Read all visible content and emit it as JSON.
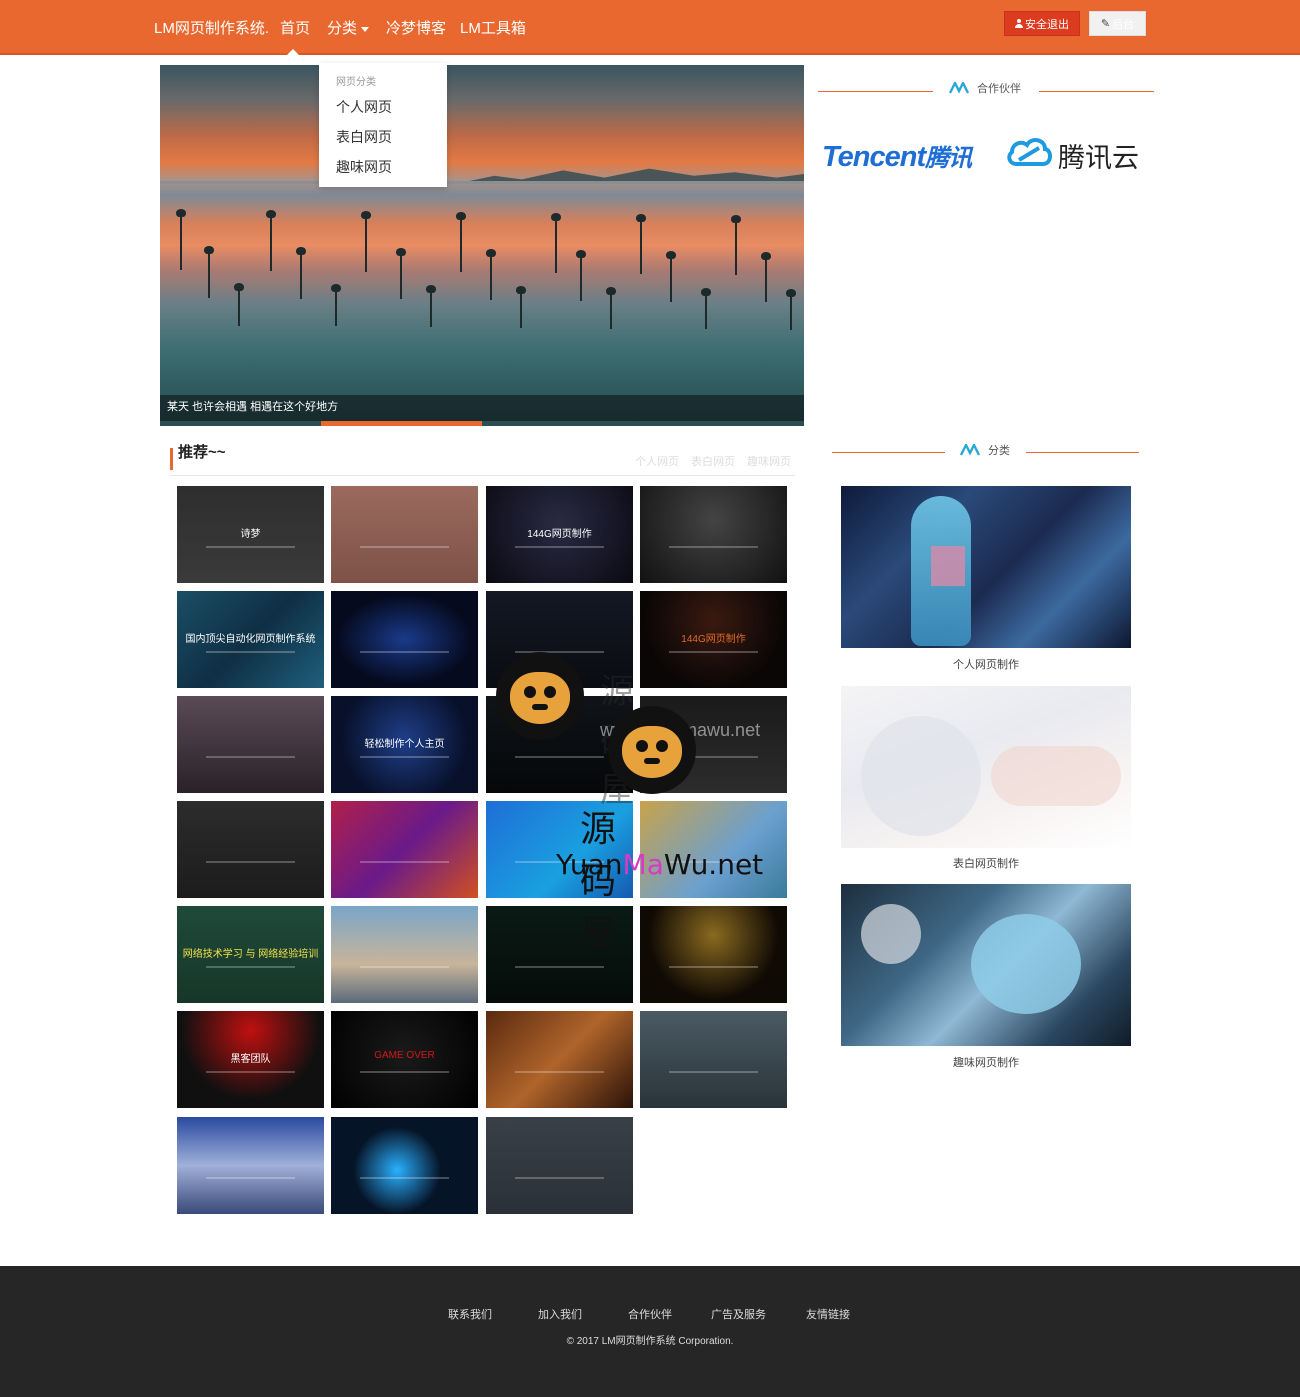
{
  "nav": {
    "brand": "LM网页制作系统.",
    "items": [
      {
        "label": "首页"
      },
      {
        "label": "分类"
      },
      {
        "label": "冷梦博客"
      },
      {
        "label": "LM工具箱"
      }
    ],
    "logout_label": "安全退出",
    "edit_label": "后台"
  },
  "dropdown": {
    "header": "网页分类",
    "items": [
      {
        "label": "个人网页"
      },
      {
        "label": "表白网页"
      },
      {
        "label": "趣味网页"
      }
    ]
  },
  "hero": {
    "caption": "某天 也许会相遇 相遇在这个好地方",
    "progress_fraction": 0.25
  },
  "recommend": {
    "title": "推荐~~",
    "tabs": [
      {
        "label": "个人网页"
      },
      {
        "label": "表白网页"
      },
      {
        "label": "趣味网页"
      }
    ],
    "thumbs": [
      {
        "text": "诗梦"
      },
      {
        "text": ""
      },
      {
        "text": "144G网页制作"
      },
      {
        "text": ""
      },
      {
        "text": "国内顶尖自动化网页制作系统"
      },
      {
        "text": ""
      },
      {
        "text": ""
      },
      {
        "text": "144G网页制作"
      },
      {
        "text": ""
      },
      {
        "text": "轻松制作个人主页"
      },
      {
        "text": ""
      },
      {
        "text": ""
      },
      {
        "text": ""
      },
      {
        "text": ""
      },
      {
        "text": ""
      },
      {
        "text": ""
      },
      {
        "text": "网络技术学习 与 网络经验培训"
      },
      {
        "text": ""
      },
      {
        "text": ""
      },
      {
        "text": ""
      },
      {
        "text": "黑客团队"
      },
      {
        "text": "GAME OVER"
      },
      {
        "text": ""
      },
      {
        "text": ""
      },
      {
        "text": ""
      },
      {
        "text": ""
      },
      {
        "text": ""
      }
    ]
  },
  "sidebar": {
    "partners_title": "合作伙伴",
    "partner_tencent_latin": "Tencent",
    "partner_tencent_cn": "腾讯",
    "partner_cloud": "腾讯云",
    "category_title": "分类",
    "categories": [
      {
        "label": "个人网页制作"
      },
      {
        "label": "表白网页制作"
      },
      {
        "label": "趣味网页制作"
      }
    ]
  },
  "watermark": {
    "cn": "源码屋",
    "url": "www.yuanmawu.net",
    "latin_a": "Yuan",
    "latin_b": "Ma",
    "latin_c": "Wu.net"
  },
  "footer": {
    "links": [
      {
        "label": "联系我们"
      },
      {
        "label": "加入我们"
      },
      {
        "label": "合作伙伴"
      },
      {
        "label": "广告及服务"
      },
      {
        "label": "友情链接"
      }
    ],
    "copyright": "© 2017 LM网页制作系统 Corporation."
  },
  "colors": {
    "accent": "#e8682f",
    "logout_button": "#dc3b20",
    "footer_bg": "#262626"
  }
}
